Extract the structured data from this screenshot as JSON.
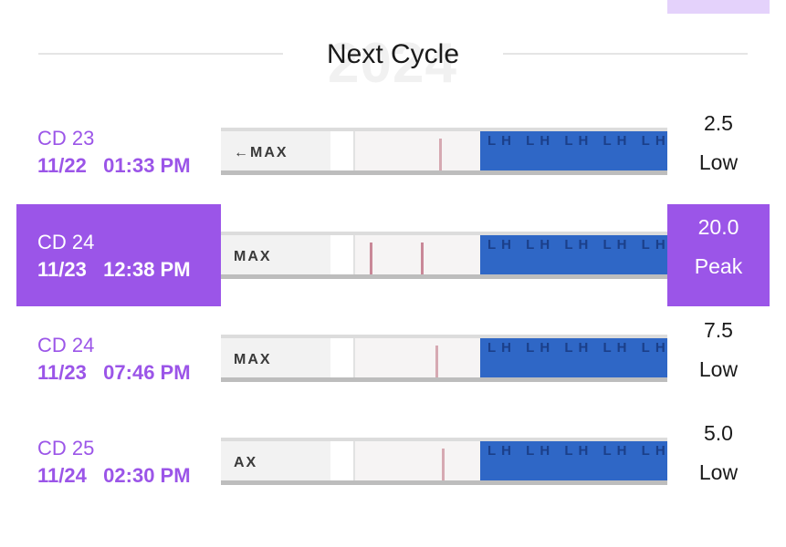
{
  "header": {
    "title": "Next Cycle",
    "watermark": "2024"
  },
  "tests": [
    {
      "cd": "CD 23",
      "datetime": "11/22   01:33 PM",
      "value": "2.5",
      "level": "Low",
      "selected": false,
      "strip_marker": "MAX",
      "pad_text": "LH LH LH LH LH"
    },
    {
      "cd": "CD 24",
      "datetime": "11/23   12:38 PM",
      "value": "20.0",
      "level": "Peak",
      "selected": true,
      "strip_marker": "MAX",
      "pad_text": "LH LH LH LH LH"
    },
    {
      "cd": "CD 24",
      "datetime": "11/23   07:46 PM",
      "value": "7.5",
      "level": "Low",
      "selected": false,
      "strip_marker": "MAX",
      "pad_text": "LH LH LH LH LH"
    },
    {
      "cd": "CD 25",
      "datetime": "11/24   02:30 PM",
      "value": "5.0",
      "level": "Low",
      "selected": false,
      "strip_marker": "AX",
      "pad_text": "LH LH LH LH LH"
    }
  ],
  "colors": {
    "accent": "#9b55e8",
    "accent_light": "#e4d2fb",
    "strip_pad": "#2f67c6"
  }
}
